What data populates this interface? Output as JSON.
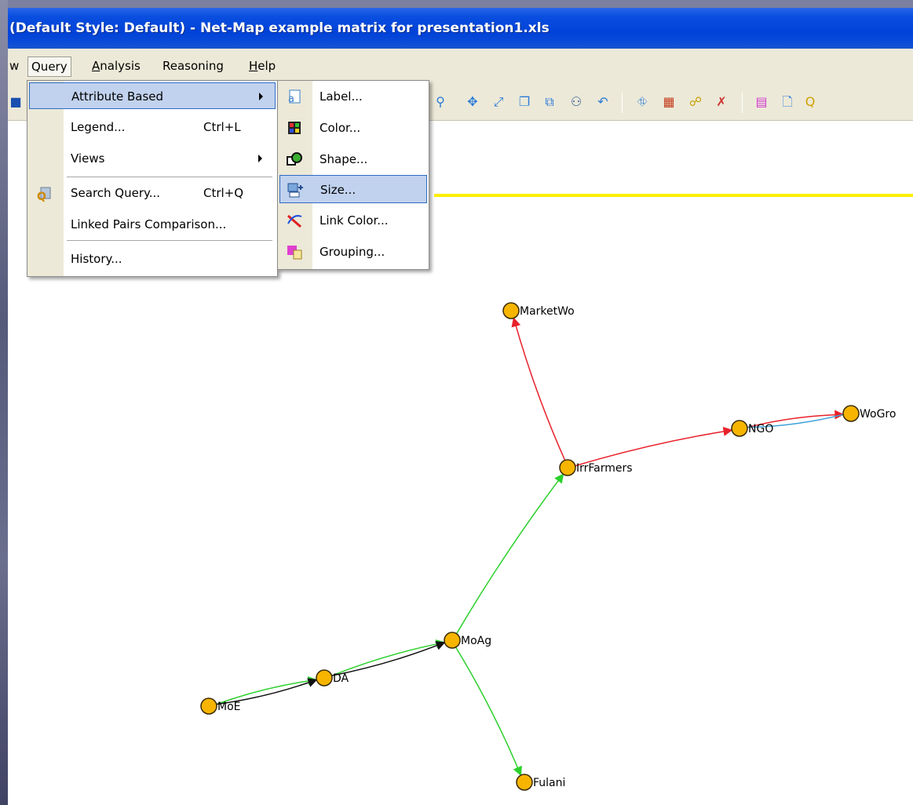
{
  "window": {
    "title": "(Default Style: Default) - Net-Map example matrix for presentation1.xls"
  },
  "menubar": {
    "items": [
      {
        "label": "w"
      },
      {
        "label": "Query"
      },
      {
        "label": "Analysis"
      },
      {
        "label": "Reasoning"
      },
      {
        "label": "Help"
      }
    ]
  },
  "query_menu": {
    "items": [
      {
        "label": "Attribute Based",
        "shortcut": "",
        "submenu": true
      },
      {
        "label": "Legend...",
        "shortcut": "Ctrl+L",
        "submenu": false
      },
      {
        "label": "Views",
        "shortcut": "",
        "submenu": true
      },
      {
        "label": "Search Query...",
        "shortcut": "Ctrl+Q",
        "submenu": false
      },
      {
        "label": "Linked Pairs Comparison...",
        "shortcut": "",
        "submenu": false
      },
      {
        "label": "History...",
        "shortcut": "",
        "submenu": false
      }
    ],
    "highlighted": "Attribute Based"
  },
  "attribute_submenu": {
    "items": [
      {
        "label": "Label...",
        "icon": "label-icon"
      },
      {
        "label": "Color...",
        "icon": "color-icon"
      },
      {
        "label": "Shape...",
        "icon": "shape-icon"
      },
      {
        "label": "Size...",
        "icon": "size-icon"
      },
      {
        "label": "Link Color...",
        "icon": "link-color-icon"
      },
      {
        "label": "Grouping...",
        "icon": "grouping-icon"
      }
    ],
    "highlighted": "Size..."
  },
  "graph": {
    "node_color": "#f7b500",
    "nodes": [
      {
        "id": "MarketWo",
        "label": "MarketWo"
      },
      {
        "id": "IrrFarmers",
        "label": "IrrFarmers"
      },
      {
        "id": "NGO",
        "label": "NGO"
      },
      {
        "id": "WoGro",
        "label": "WoGro"
      },
      {
        "id": "MoAg",
        "label": "MoAg"
      },
      {
        "id": "DA",
        "label": "DA"
      },
      {
        "id": "MoE",
        "label": "MoE"
      },
      {
        "id": "Fulani",
        "label": "Fulani"
      }
    ],
    "edges": [
      {
        "from": "IrrFarmers",
        "to": "MarketWo",
        "color": "#e8202a"
      },
      {
        "from": "IrrFarmers",
        "to": "NGO",
        "color": "#e8202a"
      },
      {
        "from": "NGO",
        "to": "WoGro",
        "color": "#e8202a"
      },
      {
        "from": "NGO",
        "to": "WoGro",
        "color": "#3aa0d8"
      },
      {
        "from": "MoAg",
        "to": "IrrFarmers",
        "color": "#2bd02b"
      },
      {
        "from": "MoAg",
        "to": "Fulani",
        "color": "#2bd02b"
      },
      {
        "from": "DA",
        "to": "MoAg",
        "color": "#2bd02b"
      },
      {
        "from": "DA",
        "to": "MoAg",
        "color": "#111111"
      },
      {
        "from": "MoE",
        "to": "DA",
        "color": "#2bd02b"
      },
      {
        "from": "MoE",
        "to": "DA",
        "color": "#111111"
      }
    ]
  },
  "highlight_line_color": "#ffee00"
}
